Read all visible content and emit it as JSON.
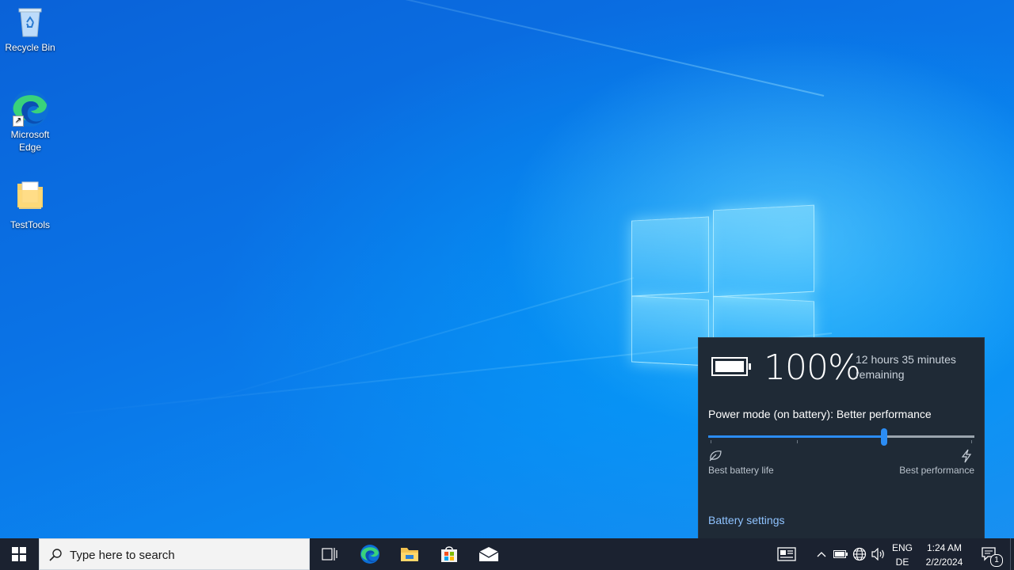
{
  "desktop": {
    "icons": [
      {
        "label": "Recycle Bin",
        "icon": "recycle-bin-icon"
      },
      {
        "label": "Microsoft Edge",
        "icon": "edge-icon"
      },
      {
        "label": "TestTools",
        "icon": "folder-icon"
      }
    ]
  },
  "battery_flyout": {
    "percent": "100%",
    "remaining": "12 hours 35 minutes remaining",
    "power_mode_label": "Power mode (on battery): Better performance",
    "slider_level": 0.66,
    "left_caption": "Best battery life",
    "right_caption": "Best performance",
    "settings_link": "Battery settings"
  },
  "taskbar": {
    "search_placeholder": "Type here to search",
    "pinned": [
      "task-view-icon",
      "edge-icon",
      "file-explorer-icon",
      "store-icon",
      "mail-icon"
    ],
    "tray": {
      "lang_top": "ENG",
      "lang_bottom": "DE",
      "time": "1:24 AM",
      "date": "2/2/2024",
      "notification_count": "1"
    }
  },
  "colors": {
    "flyout_bg": "#1f2a36",
    "accent": "#2b8cf3",
    "link": "#8fc3ff",
    "taskbar_bg": "#1b2230"
  }
}
